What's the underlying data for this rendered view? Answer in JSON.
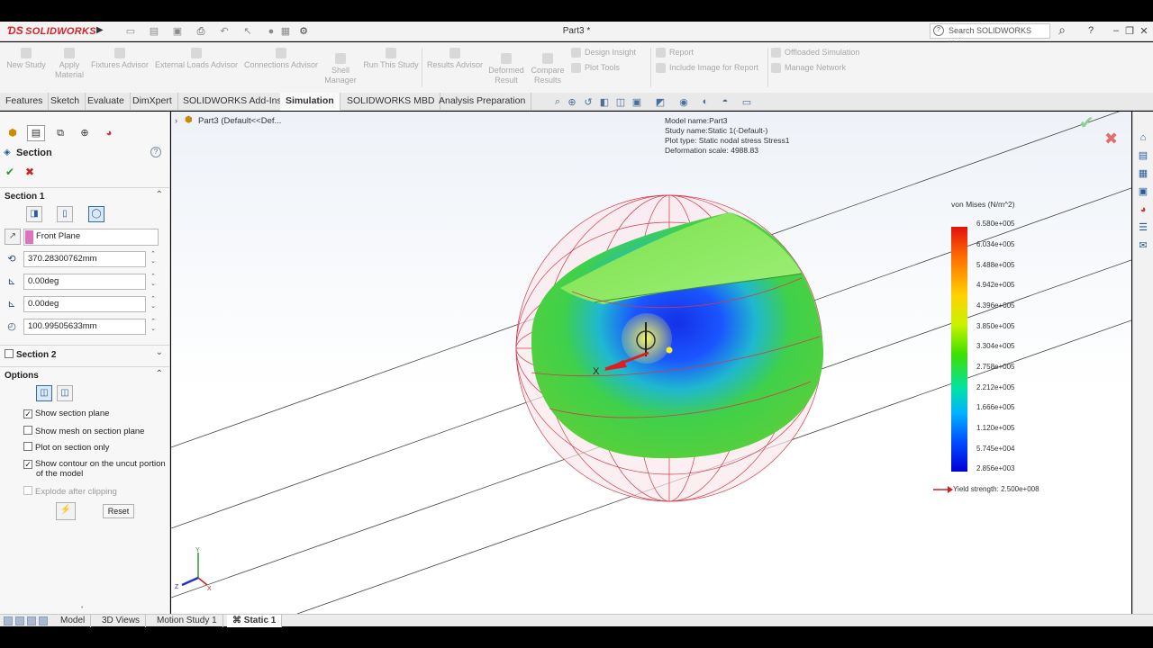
{
  "app": {
    "brand": "SOLIDWORKS",
    "doc_title": "Part3 *"
  },
  "titlebar": {
    "search_placeholder": "Search SOLIDWORKS Help",
    "help": "?",
    "minimize": "–",
    "restore": "❐",
    "close": "✕"
  },
  "commands": [
    {
      "label": "New Study",
      "sub": "",
      "icon": "new-study-icon"
    },
    {
      "label": "Apply",
      "sub": "Material",
      "icon": "apply-material-icon"
    },
    {
      "label": "Fixtures Advisor",
      "sub": "",
      "icon": "fixtures-icon"
    },
    {
      "label": "External Loads Advisor",
      "sub": "",
      "icon": "loads-icon"
    },
    {
      "label": "Connections Advisor",
      "sub": "",
      "icon": "connections-icon"
    },
    {
      "label": "Shell",
      "sub": "Manager",
      "icon": "shell-icon"
    },
    {
      "label": "Run This Study",
      "sub": "",
      "icon": "run-icon"
    },
    {
      "label": "Results Advisor",
      "sub": "",
      "icon": "results-icon"
    },
    {
      "label": "Deformed",
      "sub": "Result",
      "icon": "deformed-icon"
    },
    {
      "label": "Compare",
      "sub": "Results",
      "icon": "compare-icon"
    }
  ],
  "command_rows": {
    "design_insight": "Design Insight",
    "plot_tools": "Plot Tools",
    "report": "Report",
    "include_image": "Include Image for Report",
    "offloaded": "Offloaded Simulation",
    "manage_network": "Manage Network"
  },
  "tabs": [
    "Features",
    "Sketch",
    "Evaluate",
    "DimXpert",
    "SOLIDWORKS Add-Ins",
    "Simulation",
    "SOLIDWORKS MBD",
    "Analysis Preparation"
  ],
  "active_tab": "Simulation",
  "property_manager": {
    "title": "Section",
    "section1": {
      "label": "Section 1",
      "plane": "Front Plane",
      "offset": "370.28300762mm",
      "rot_x": "0.00deg",
      "rot_y": "0.00deg",
      "radius": "100.99505633mm"
    },
    "section2_label": "Section 2",
    "options": {
      "label": "Options",
      "show_section_plane": "Show section plane",
      "show_mesh": "Show mesh on section plane",
      "plot_on_section": "Plot on section only",
      "show_contour_l1": "Show contour on the uncut portion",
      "show_contour_l2": "of the model",
      "explode": "Explode after clipping",
      "reset": "Reset"
    }
  },
  "tree": {
    "item": "Part3  (Default<<Def..."
  },
  "viewport": {
    "info": [
      "Model name:Part3",
      "Study name:Static 1(-Default-)",
      "Plot type: Static nodal stress Stress1",
      "Deformation scale: 4988.83"
    ],
    "legend_title": "von Mises (N/m^2)",
    "legend_values": [
      "6.580e+005",
      "6.034e+005",
      "5.488e+005",
      "4.942e+005",
      "4.396e+005",
      "3.850e+005",
      "3.304e+005",
      "2.758e+005",
      "2.212e+005",
      "1.666e+005",
      "1.120e+005",
      "5.745e+004",
      "2.856e+003"
    ],
    "yield": "Yield strength: 2.500e+008",
    "axis_x": "X",
    "triad": {
      "x": "X",
      "y": "Y",
      "z": "Z"
    }
  },
  "bottom_tabs": [
    "Model",
    "3D Views",
    "Motion Study 1",
    "Static 1"
  ],
  "colors": {
    "brand": "#d3232a",
    "accent": "#2e6bb4"
  }
}
